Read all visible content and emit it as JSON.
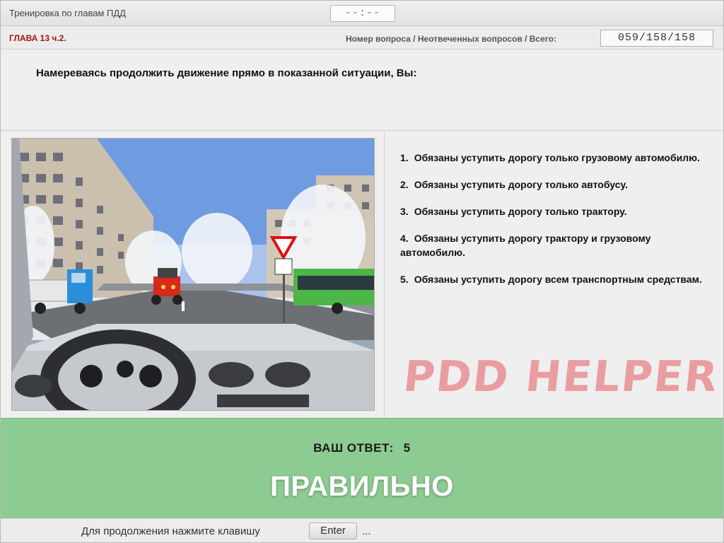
{
  "window": {
    "title": "Тренировка по главам ПДД",
    "timer": "--:--"
  },
  "header": {
    "chapter": "ГЛАВА 13 ч.2.",
    "counter_label": "Номер вопроса / Неотвеченных вопросов / Всего:",
    "counter_value": "059/158/158"
  },
  "question": {
    "text": "Намереваясь продолжить движение прямо в показанной ситуации, Вы:"
  },
  "answers": [
    {
      "num": "1.",
      "text": "Обязаны уступить дорогу только грузовому автомобилю."
    },
    {
      "num": "2.",
      "text": "Обязаны уступить дорогу только автобусу."
    },
    {
      "num": "3.",
      "text": "Обязаны уступить дорогу только трактору."
    },
    {
      "num": "4.",
      "text": "Обязаны уступить дорогу трактору и грузовому автомобилю."
    },
    {
      "num": "5.",
      "text": "Обязаны уступить дорогу всем транспортным средствам."
    }
  ],
  "watermark": "PDD HELPER",
  "result": {
    "label": "ВАШ  ОТВЕТ:",
    "value": "5",
    "verdict": "ПРАВИЛЬНО",
    "color": "#8ccb92"
  },
  "footer": {
    "text": "Для продолжения нажмите клавишу",
    "key": "Enter",
    "ellipsis": "..."
  }
}
